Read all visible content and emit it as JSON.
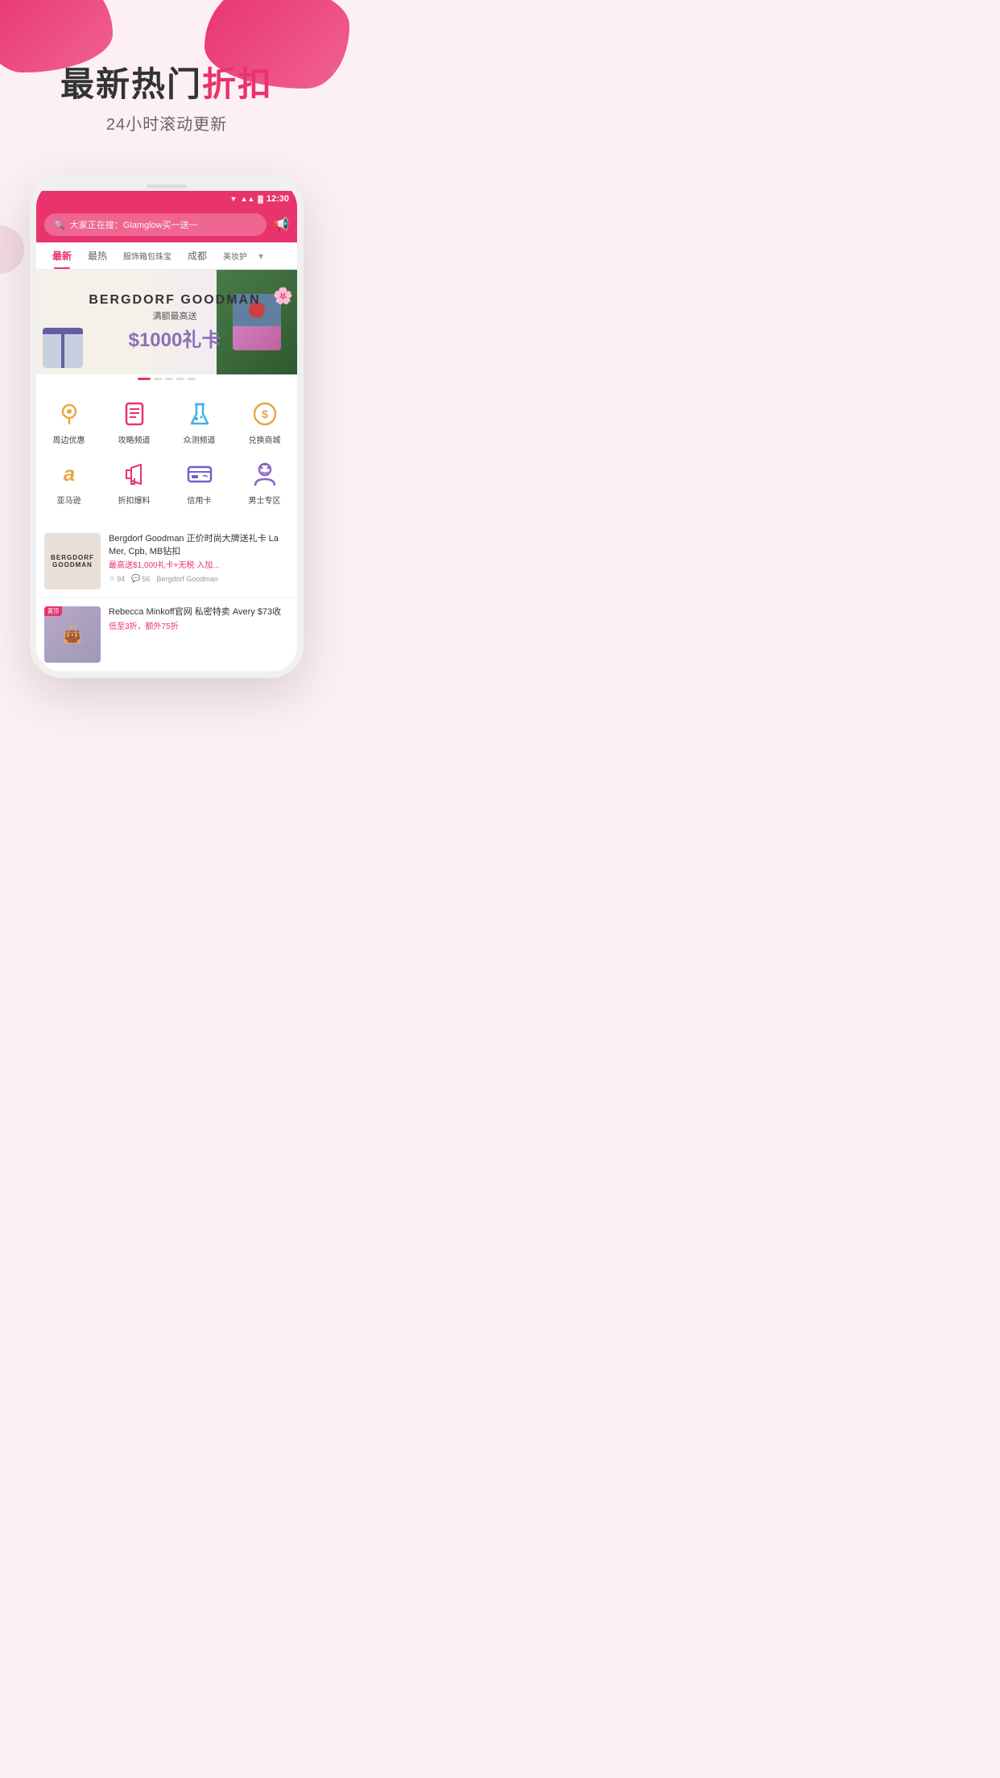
{
  "hero": {
    "title_part1": "最新热门",
    "title_part2": "折扣",
    "subtitle": "24小时滚动更新"
  },
  "status_bar": {
    "time": "12:30",
    "wifi_icon": "▼",
    "signal_icon": "▲",
    "battery_icon": "▓"
  },
  "search": {
    "placeholder": "大家正在搜：Glamglow买一送一",
    "announce_icon": "📢"
  },
  "nav_tabs": [
    {
      "label": "最新",
      "active": true
    },
    {
      "label": "最热",
      "active": false
    },
    {
      "label": "服饰箱包珠宝",
      "active": false
    },
    {
      "label": "成都",
      "active": false
    },
    {
      "label": "美妆护",
      "active": false
    }
  ],
  "banner": {
    "brand": "BERGDORF GOODMAN",
    "subtitle": "满额最高送",
    "amount": "$1000礼卡",
    "dots": [
      true,
      false,
      false,
      false,
      false
    ]
  },
  "categories": [
    {
      "label": "周边优惠",
      "icon": "location",
      "color": "#e8a840"
    },
    {
      "label": "攻略频道",
      "icon": "document",
      "color": "#e8336d"
    },
    {
      "label": "众测频道",
      "icon": "flask",
      "color": "#40b0e8"
    },
    {
      "label": "兑换商城",
      "icon": "dollar",
      "color": "#e8a840"
    },
    {
      "label": "亚马逊",
      "icon": "amazon",
      "color": "#e8a840"
    },
    {
      "label": "折扣爆料",
      "icon": "megaphone",
      "color": "#e8336d"
    },
    {
      "label": "信用卡",
      "icon": "card",
      "color": "#7060c8"
    },
    {
      "label": "男士专区",
      "icon": "avatar",
      "color": "#9060c8"
    }
  ],
  "deals": [
    {
      "brand": "BERGDORF\nGOODMAN",
      "title": "Bergdorf Goodman 正价时尚大牌送礼卡 La Mer, Cpb, MB钻扣",
      "desc": "最高送$1,000礼卡+无税 入加...",
      "stars": "94",
      "comments": "56",
      "source": "Bergdorf Goodman",
      "pinned": false
    },
    {
      "brand": "置顶",
      "title": "Rebecca Minkoff官网 私密特卖 Avery $73收",
      "desc": "低至3折，额外75折",
      "stars": "",
      "comments": "",
      "source": "",
      "pinned": true
    }
  ]
}
